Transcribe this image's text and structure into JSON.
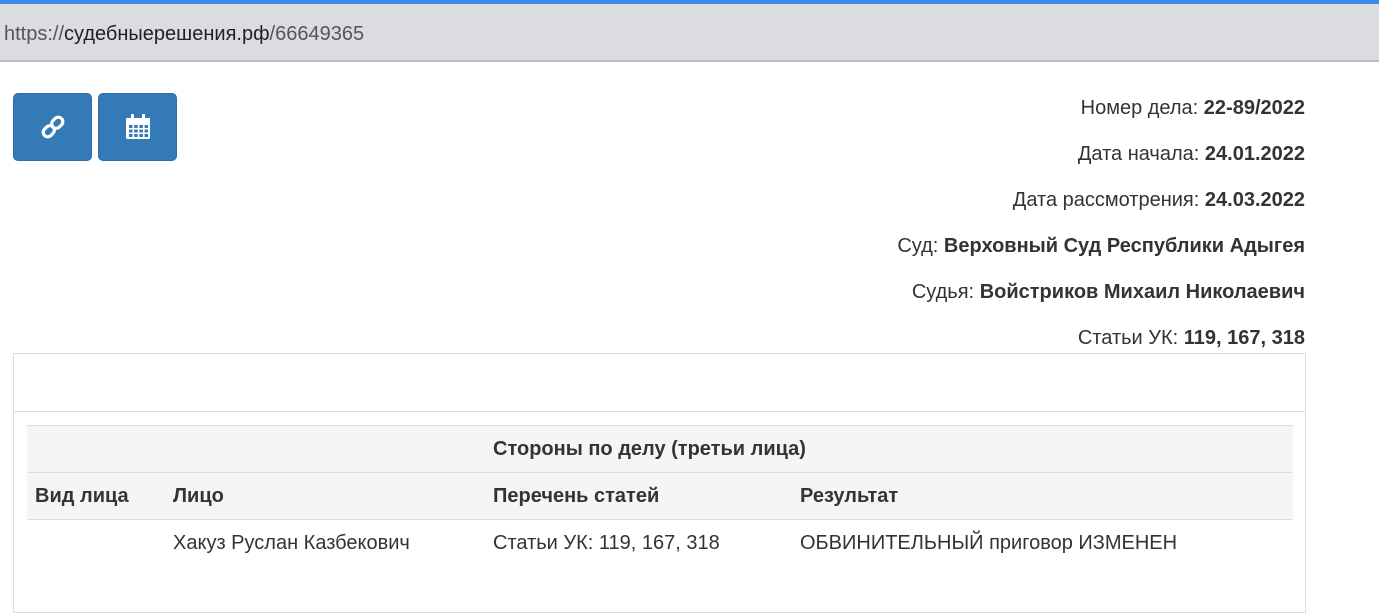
{
  "browser": {
    "url_scheme": "https://",
    "url_host": "судебныерешения.рф",
    "url_path": "/66649365"
  },
  "toolbar": {
    "buttons": [
      {
        "icon": "link-icon"
      },
      {
        "icon": "calendar-icon"
      }
    ]
  },
  "case_info": {
    "number_label": "Номер дела:",
    "number_value": "22-89/2022",
    "start_label": "Дата начала:",
    "start_value": "24.01.2022",
    "review_label": "Дата рассмотрения:",
    "review_value": "24.03.2022",
    "court_label": "Суд:",
    "court_value": "Верховный Суд Республики Адыгея",
    "judge_label": "Судья:",
    "judge_value": "Войстриков Михаил Николаевич",
    "articles_label": "Статьи УК:",
    "articles_value": "119, 167, 318"
  },
  "parties": {
    "title": "Стороны по делу (третьи лица)",
    "columns": [
      "Вид лица",
      "Лицо",
      "Перечень статей",
      "Результат"
    ],
    "rows": [
      {
        "type": "",
        "person": "Хакуз Руслан Казбекович",
        "articles": "Статьи УК: 119, 167, 318",
        "result": "ОБВИНИТЕЛЬНЫЙ приговор ИЗМЕНЕН"
      }
    ]
  },
  "colors": {
    "accent": "#3c8be6",
    "button": "#337ab7",
    "table_header_bg": "#f5f5f5"
  }
}
